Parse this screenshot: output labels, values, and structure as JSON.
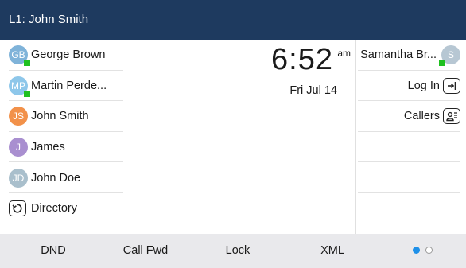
{
  "header": {
    "title": "L1: John Smith"
  },
  "left_keys": [
    {
      "initials": "GB",
      "label": "George Brown",
      "avatar_color": "#7fb3d9",
      "presence": true
    },
    {
      "initials": "MP",
      "label": "Martin Perde...",
      "avatar_color": "#8ec7ea",
      "presence": true
    },
    {
      "initials": "JS",
      "label": "John Smith",
      "avatar_color": "#f2914a",
      "presence": false
    },
    {
      "initials": "J",
      "label": "James",
      "avatar_color": "#a98fd0",
      "presence": false
    },
    {
      "initials": "JD",
      "label": "John Doe",
      "avatar_color": "#a9bfcc",
      "presence": false
    },
    {
      "icon": "directory-icon",
      "label": "Directory"
    }
  ],
  "clock": {
    "time": "6:52",
    "ampm": "am",
    "date": "Fri Jul 14"
  },
  "right_keys": [
    {
      "initials": "S",
      "label": "Samantha Br...",
      "avatar_color": "#b7c7d3",
      "presence": true
    },
    {
      "icon": "login-icon",
      "label": "Log In"
    },
    {
      "icon": "callers-icon",
      "label": "Callers"
    }
  ],
  "softkeys": [
    {
      "label": "DND"
    },
    {
      "label": "Call Fwd"
    },
    {
      "label": "Lock"
    },
    {
      "label": "XML"
    }
  ],
  "pager": {
    "pages": 2,
    "current": 1
  },
  "colors": {
    "header_bg": "#1e3a5f",
    "presence": "#1fc01f",
    "pager_active": "#1e90e8",
    "softkey_bg": "#e9e9ec"
  }
}
